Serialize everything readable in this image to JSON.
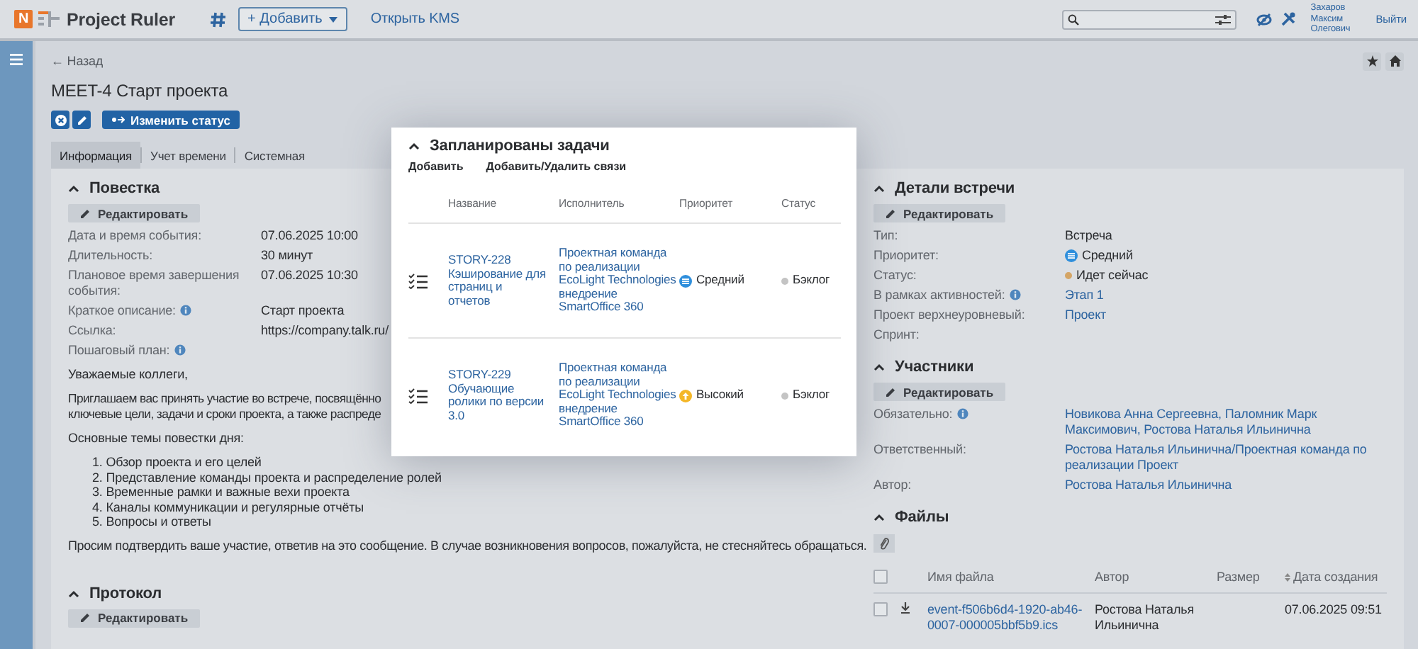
{
  "topbar": {
    "logo_letter": "N",
    "app_name": "Project Ruler",
    "add_button": "+ Добавить",
    "kms_link": "Открыть KMS",
    "user_name": "Захаров Максим Олегович",
    "logout": "Выйти"
  },
  "back": "← Назад",
  "title": "MEET-4 Старт проекта",
  "status_button": "Изменить статус",
  "tabs": [
    {
      "label": "Информация",
      "selected": true
    },
    {
      "label": "Учет времени",
      "selected": false
    },
    {
      "label": "Системная",
      "selected": false
    }
  ],
  "agenda": {
    "title": "Повестка",
    "expanded": true,
    "edit": "Редактировать",
    "fields": [
      {
        "label": "Дата и время события:",
        "info": false,
        "value": {
          "kind": "text",
          "text": "07.06.2025 10:00"
        }
      },
      {
        "label": "Длительность:",
        "info": false,
        "value": {
          "kind": "text",
          "text": "30 минут"
        }
      },
      {
        "label": "Плановое время завершения события:",
        "info": false,
        "value": {
          "kind": "text",
          "text": "07.06.2025 10:30"
        }
      },
      {
        "label": "Краткое описание:",
        "info": true,
        "value": {
          "kind": "text",
          "text": "Старт проекта"
        }
      },
      {
        "label": "Ссылка:",
        "info": false,
        "value": {
          "kind": "text",
          "text": "https://company.talk.ru/"
        }
      },
      {
        "label": "Пошаговый план:",
        "info": true
      }
    ],
    "greeting": "Уважаемые коллеги,",
    "intro_lines": [
      "Приглашаем вас принять участие во встрече, посвящённо",
      "ключевые цели, задачи и сроки проекта, а также распреде"
    ],
    "topics_title": "Основные темы повестки дня:",
    "topics": [
      "1. Обзор проекта и его целей",
      "2. Представление команды проекта и распределение ролей",
      "3. Временные рамки и важные вехи проекта",
      "4. Каналы коммуникации и регулярные отчёты",
      "5. Вопросы и ответы"
    ],
    "closing": "Просим подтвердить ваше участие, ответив на это сообщение. В случае возникновения вопросов, пожалуйста, не стесняйтесь обращаться."
  },
  "protocol": {
    "title": "Протокол",
    "expanded": true,
    "edit": "Редактировать"
  },
  "details": {
    "title": "Детали встречи",
    "expanded": true,
    "edit": "Редактировать",
    "fields": [
      {
        "label": "Тип:",
        "info": false,
        "value": {
          "kind": "text",
          "text": "Встреча"
        }
      },
      {
        "label": "Приоритет:",
        "info": false,
        "value": {
          "kind": "priority",
          "icon": {
            "kind": "medium",
            "color": "#2f8fdc"
          },
          "text": "Средний"
        }
      },
      {
        "label": "Статус:",
        "info": false,
        "value": {
          "kind": "status",
          "color": "#d4a566",
          "text": "Идет сейчас"
        }
      },
      {
        "label": "В рамках активностей:",
        "info": true,
        "value": {
          "kind": "link",
          "text": "Этап 1"
        }
      },
      {
        "label": "Проект верхнеуровневый:",
        "info": false,
        "value": {
          "kind": "link",
          "text": "Проект"
        }
      },
      {
        "label": "Спринт:",
        "info": false
      }
    ]
  },
  "participants": {
    "title": "Участники",
    "expanded": true,
    "edit": "Редактировать",
    "fields": [
      {
        "label": "Обязательно:",
        "info": true,
        "value": {
          "kind": "link",
          "text": "Новикова Анна Сергеевна, Паломник Марк Максимович, Ростова Наталья Ильинична"
        }
      },
      {
        "label": "Ответственный:",
        "info": false,
        "value": {
          "kind": "link",
          "text": "Ростова Наталья Ильинична/Проектная команда по реализации Проект"
        }
      },
      {
        "label": "Автор:",
        "info": false,
        "value": {
          "kind": "link",
          "text": "Ростова Наталья Ильинична"
        }
      }
    ]
  },
  "files": {
    "title": "Файлы",
    "expanded": true,
    "columns": [
      "Имя файла",
      "Автор",
      "Размер",
      "Дата создания"
    ],
    "header_checked": false,
    "rows": [
      {
        "checked": false,
        "name": "event-f506b6d4-1920-ab46-0007-000005bbf5b9.ics",
        "author": "Ростова Наталья Ильинична",
        "date": "07.06.2025 09:51"
      }
    ]
  },
  "popup": {
    "title": "Запланированы задачи",
    "expanded": true,
    "actions": [
      "Добавить",
      "Добавить/Удалить связи"
    ],
    "columns": [
      "Название",
      "Исполнитель",
      "Приоритет",
      "Статус"
    ],
    "rows": [
      {
        "title": "STORY-228 Кэширование для страниц и отчетов",
        "assignee": "Проектная команда по реализации EcoLight Technologies внедрение SmartOffice 360",
        "priority": {
          "icon": {
            "kind": "medium",
            "color": "#2f8fdc"
          },
          "text": "Средний"
        },
        "status": {
          "color": "#c4c4c4",
          "text": "Бэклог"
        }
      },
      {
        "title": "STORY-229 Обучающие ролики по версии 3.0",
        "assignee": "Проектная команда по реализации EcoLight Technologies внедрение SmartOffice 360",
        "priority": {
          "icon": {
            "kind": "high",
            "color": "#f4b728"
          },
          "text": "Высокий"
        },
        "status": {
          "color": "#c4c4c4",
          "text": "Бэклог"
        }
      }
    ]
  }
}
